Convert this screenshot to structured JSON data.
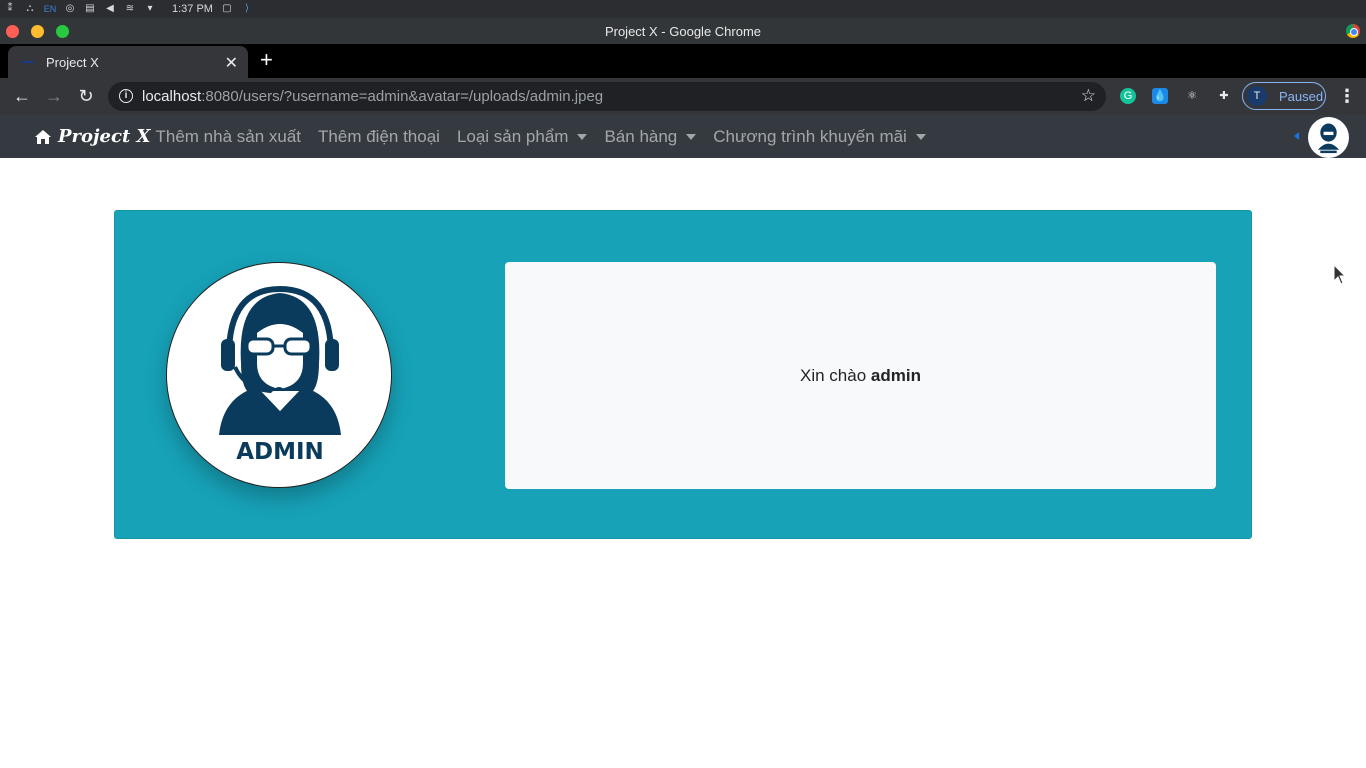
{
  "os_bar": {
    "lang": "EN",
    "clock": "1:37 PM"
  },
  "window": {
    "title": "Project X - Google Chrome"
  },
  "tab": {
    "title": "Project X",
    "close_glyph": "✕",
    "new_tab_glyph": "+"
  },
  "address_bar": {
    "host": "localhost",
    "rest": ":8080/users/?username=admin&avatar=/uploads/admin.jpeg"
  },
  "profile": {
    "initial": "T",
    "status": "Paused"
  },
  "navbar": {
    "brand": "Project X",
    "links": [
      {
        "label": "Thêm nhà sản xuất",
        "dropdown": false
      },
      {
        "label": "Thêm điện thoại",
        "dropdown": false
      },
      {
        "label": "Loại sản phẩm",
        "dropdown": true
      },
      {
        "label": "Bán hàng",
        "dropdown": true
      },
      {
        "label": "Chương trình khuyến mãi",
        "dropdown": true
      }
    ]
  },
  "profile_card": {
    "avatar_caption": "ADMIN",
    "greeting_prefix": "Xin chào",
    "username": "admin"
  },
  "colors": {
    "navbar_bg": "#343a40",
    "card_bg": "#17a2b8",
    "panel_bg": "#f8f9fa",
    "avatar_navy": "#0b3b5c"
  }
}
